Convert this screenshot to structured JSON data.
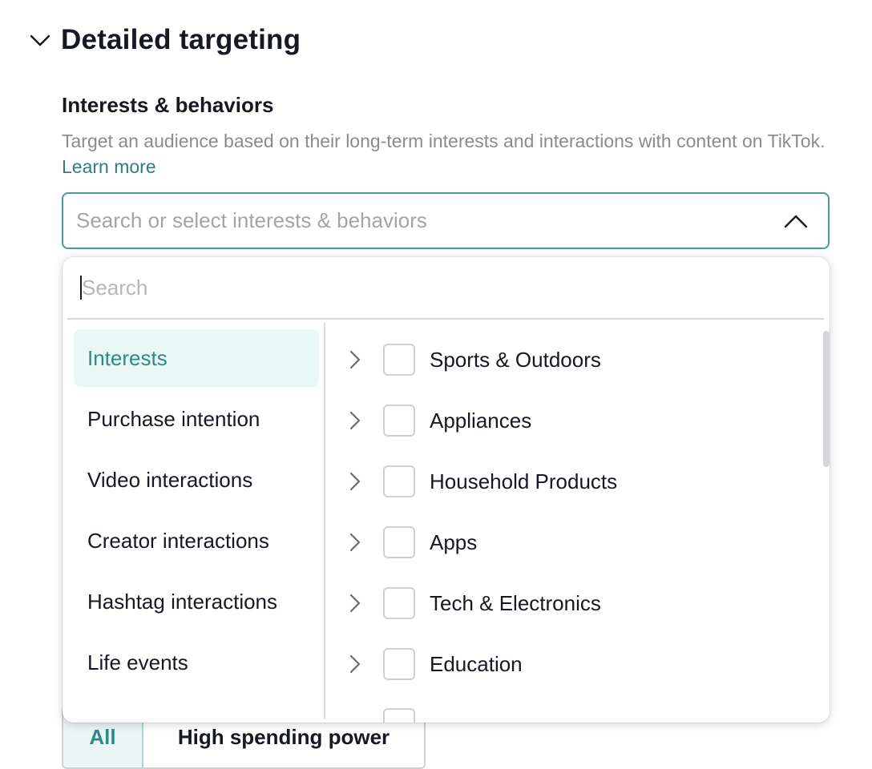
{
  "section": {
    "title": "Detailed targeting",
    "toggle_icon": "chevron-down-icon"
  },
  "field": {
    "label": "Interests & behaviors",
    "description": "Target an audience based on their long-term interests and interactions with content on TikTok.",
    "learn_more": "Learn more",
    "placeholder": "Search or select interests & behaviors",
    "toggle_icon": "chevron-up-icon"
  },
  "dropdown": {
    "search_placeholder": "Search",
    "categories": [
      {
        "label": "Interests",
        "active": true
      },
      {
        "label": "Purchase intention",
        "active": false
      },
      {
        "label": "Video interactions",
        "active": false
      },
      {
        "label": "Creator interactions",
        "active": false
      },
      {
        "label": "Hashtag interactions",
        "active": false
      },
      {
        "label": "Life events",
        "active": false
      }
    ],
    "options": [
      {
        "label": "Sports & Outdoors",
        "checked": false
      },
      {
        "label": "Appliances",
        "checked": false
      },
      {
        "label": "Household Products",
        "checked": false
      },
      {
        "label": "Apps",
        "checked": false
      },
      {
        "label": "Tech & Electronics",
        "checked": false
      },
      {
        "label": "Education",
        "checked": false
      }
    ]
  },
  "spending": {
    "all_label": "All",
    "high_label": "High spending power"
  },
  "colors": {
    "accent": "#2f8a86",
    "accent_bg": "#e9f7f6",
    "border_focus": "#4a9a96",
    "text": "#161823",
    "muted": "#8a8b91"
  }
}
